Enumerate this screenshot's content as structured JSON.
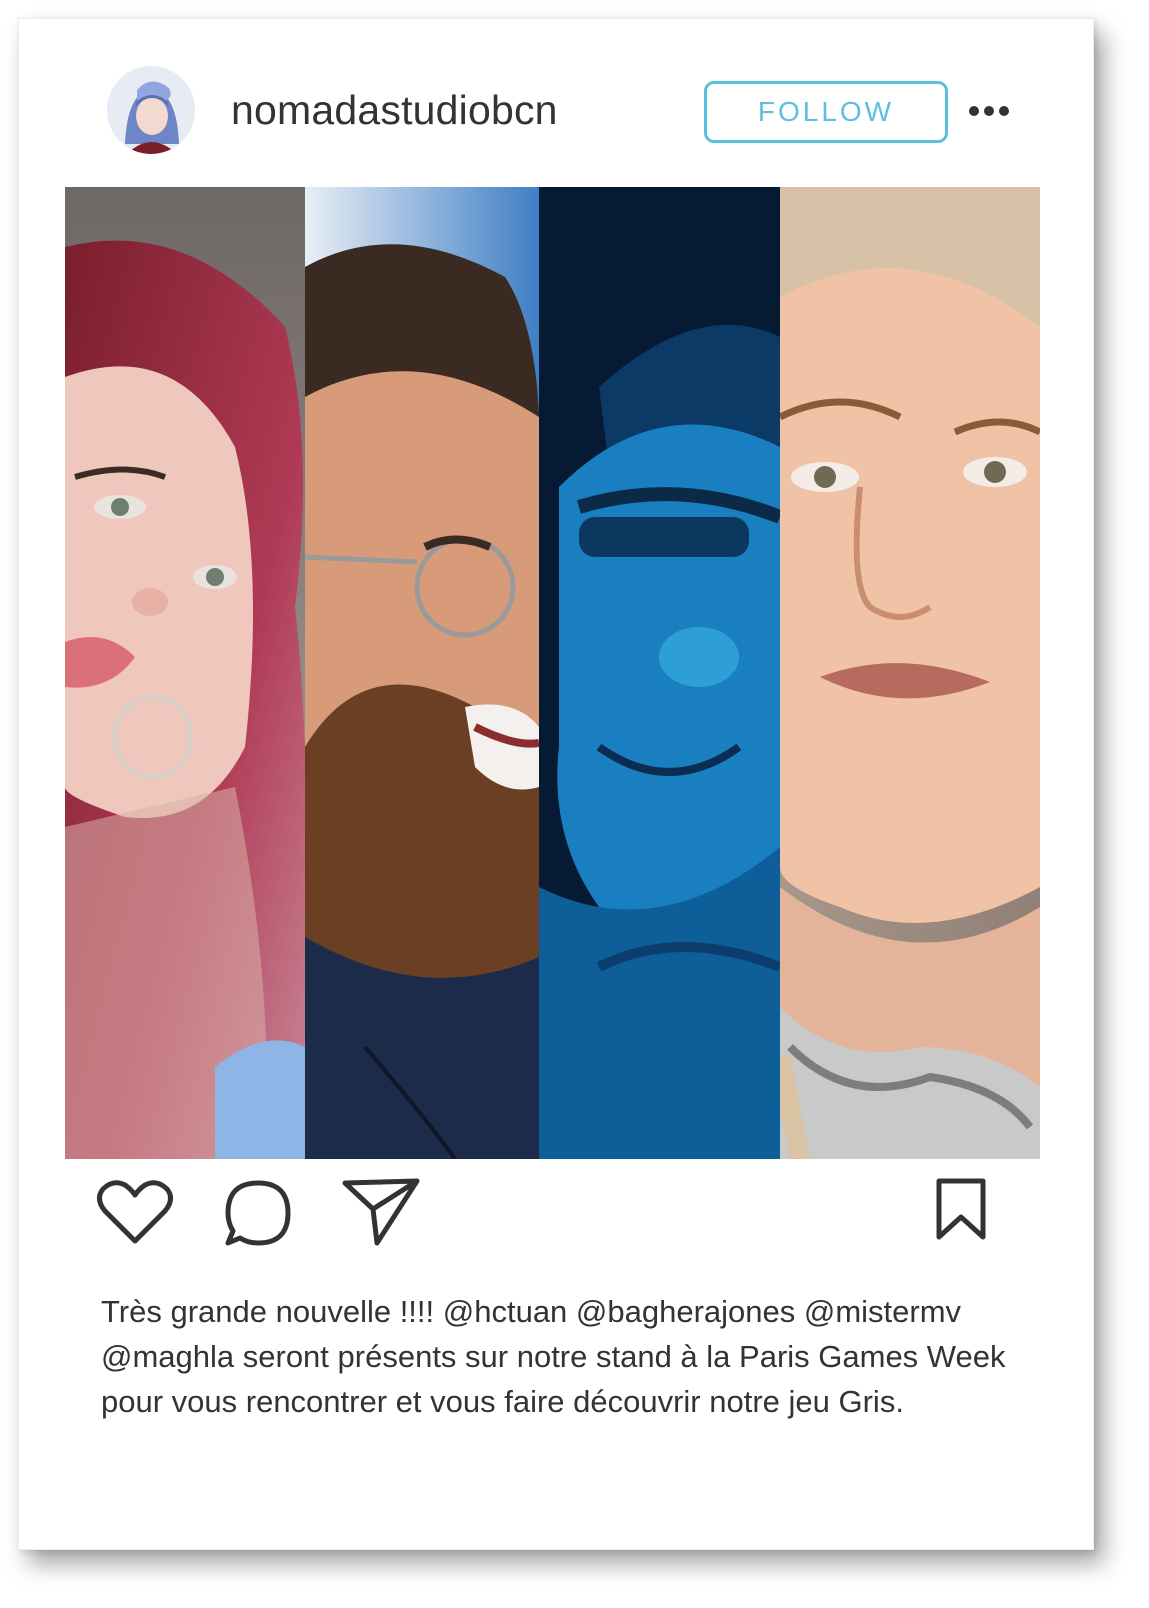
{
  "post": {
    "username": "nomadastudiobcn",
    "follow_label": "FOLLOW",
    "caption": "Très grande nouvelle !!!! @hctuan @bagherajones @mistermv @maghla seront présents sur notre stand à la Paris Games Week pour vous rencontrer et vous faire découvrir notre jeu Gris."
  },
  "colors": {
    "accent": "#5bc0de",
    "text": "#333333",
    "card_background": "#ffffff"
  },
  "icons": {
    "more": "more-dots-icon",
    "like": "heart-icon",
    "comment": "comment-bubble-icon",
    "share": "paper-plane-icon",
    "save": "bookmark-icon"
  }
}
